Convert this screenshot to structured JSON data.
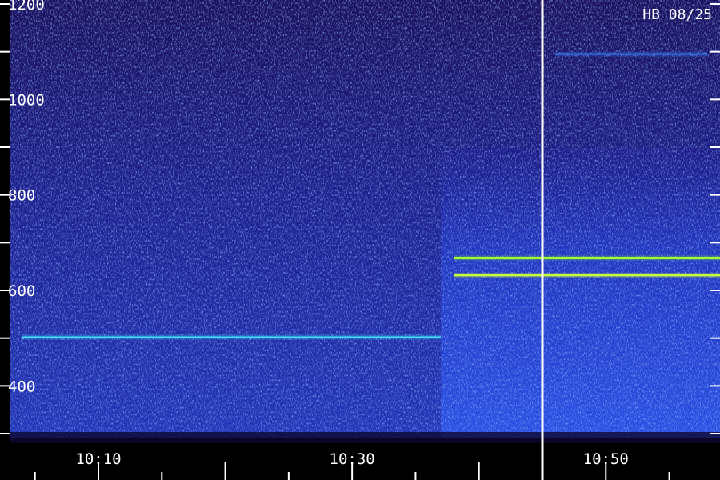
{
  "chart_data": {
    "type": "heatmap",
    "title": "",
    "station_label": "HB 08/25",
    "xlabel": "",
    "ylabel": "",
    "x_axis": {
      "unit": "time",
      "range": [
        "10:03",
        "10:59"
      ],
      "labeled_ticks": [
        "10:10",
        "10:30",
        "10:50"
      ],
      "minor_tick_step_minutes": 5
    },
    "y_axis": {
      "unit": "frequency",
      "range": [
        290,
        1200
      ],
      "tick_labels": [
        "1200",
        "1000",
        "800",
        "600",
        "400"
      ],
      "minor_tick_step": 100
    },
    "time_marker": {
      "time": "10:45",
      "color": "#ffffff"
    },
    "emission_onset_time": "10:37",
    "background_colors": [
      "#150a4a",
      "#1e1a8a",
      "#2440d0",
      "#3a7cff",
      "#40d8ff"
    ],
    "series": [
      {
        "type": "tone",
        "frequency": 668,
        "start": "10:38",
        "end": "10:59",
        "color": "#9cff2a"
      },
      {
        "type": "tone",
        "frequency": 632,
        "start": "10:38",
        "end": "10:59",
        "color": "#c8ff3c"
      },
      {
        "type": "tone",
        "frequency": 502,
        "start": "10:04",
        "end": "10:37",
        "color": "#40e0ff"
      },
      {
        "type": "tone",
        "frequency": 1095,
        "start": "10:46",
        "end": "10:58",
        "color": "#3a8cff"
      }
    ]
  }
}
